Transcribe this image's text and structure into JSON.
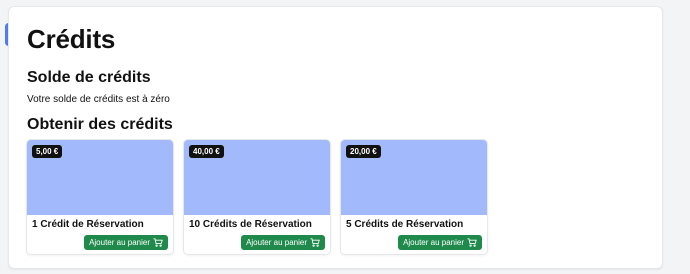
{
  "page": {
    "title": "Crédits"
  },
  "balance": {
    "heading": "Solde de crédits",
    "text": "Votre solde de crédits est à zéro"
  },
  "offers": {
    "heading": "Obtenir des crédits",
    "button_label": "Ajouter au panier",
    "items": [
      {
        "price": "5,00 €",
        "title": "1 Crédit de Réservation"
      },
      {
        "price": "40,00 €",
        "title": "10 Crédits de Réservation"
      },
      {
        "price": "20,00 €",
        "title": "5 Crédits de Réservation"
      }
    ]
  },
  "colors": {
    "accent": "#4f7df3",
    "card_image": "#a2b9fb",
    "button": "#1f8a4c",
    "badge": "#111111"
  },
  "icons": {
    "cart": "shopping-cart-icon"
  }
}
